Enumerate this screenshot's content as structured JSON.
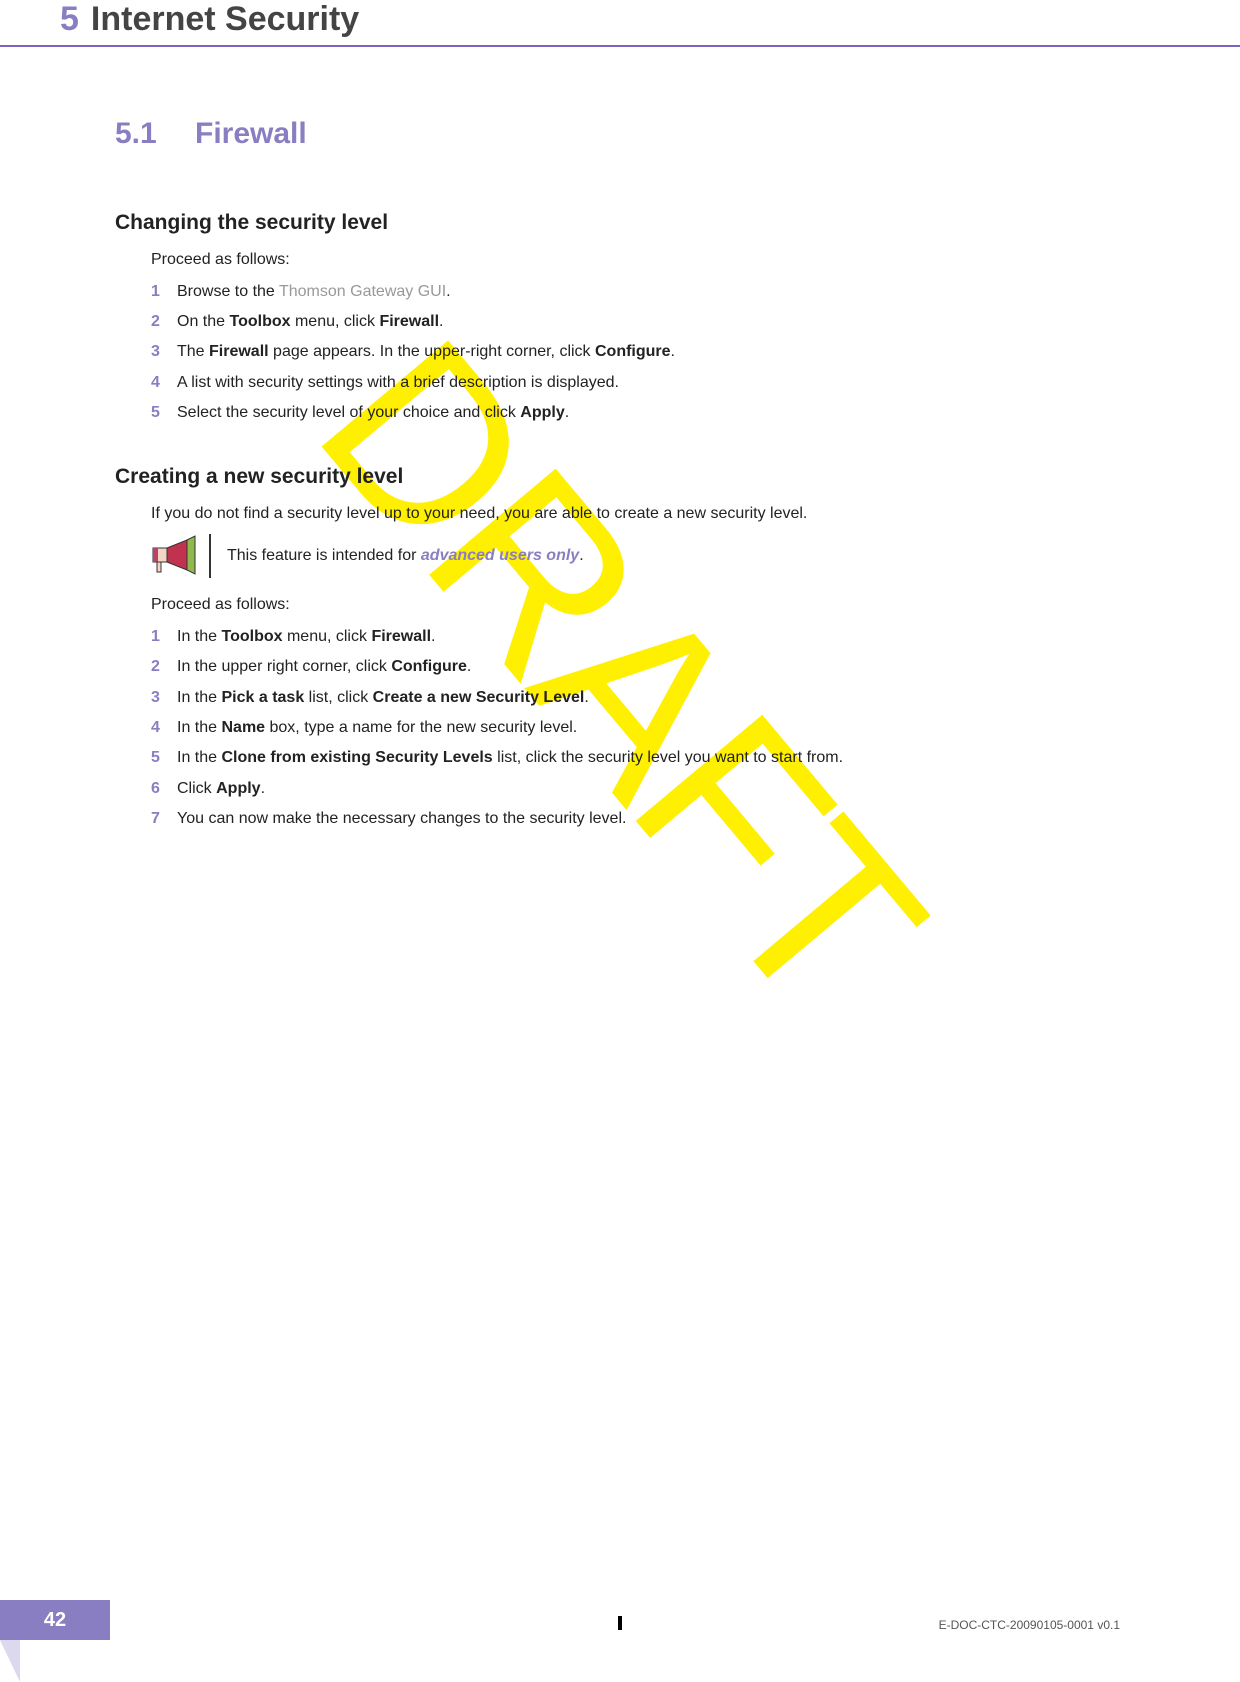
{
  "header": {
    "chapter_num": "5",
    "chapter_title": "Internet Security"
  },
  "section": {
    "num": "5.1",
    "title": "Firewall"
  },
  "block1": {
    "heading": "Changing the security level",
    "intro": "Proceed as follows:",
    "steps": [
      {
        "n": "1",
        "pre": "Browse to the ",
        "link": "Thomson Gateway GUI",
        "post": "."
      },
      {
        "n": "2",
        "pre": "On the ",
        "b1": "Toolbox",
        "mid": " menu, click ",
        "b2": "Firewall",
        "post": "."
      },
      {
        "n": "3",
        "pre": "The ",
        "b1": "Firewall",
        "mid": " page appears. In the upper-right corner, click ",
        "b2": "Configure",
        "post": "."
      },
      {
        "n": "4",
        "plain": "A list with security settings with a brief description is displayed."
      },
      {
        "n": "5",
        "pre": "Select the security level of your choice and click ",
        "b1": "Apply",
        "post": "."
      }
    ]
  },
  "block2": {
    "heading": "Creating a new security level",
    "intro1": "If you do not find a security level up to your need, you are able to create a new security level.",
    "note_pre": "This feature is intended for ",
    "note_em": "advanced users only",
    "note_post": ".",
    "intro2": "Proceed as follows:",
    "steps": [
      {
        "n": "1",
        "pre": "In the ",
        "b1": "Toolbox",
        "mid": " menu, click ",
        "b2": "Firewall",
        "post": "."
      },
      {
        "n": "2",
        "pre": "In the upper right corner, click ",
        "b1": "Configure",
        "post": "."
      },
      {
        "n": "3",
        "pre": "In the ",
        "b1": "Pick a task",
        "mid": " list, click ",
        "b2": "Create a new Security Level",
        "post": "."
      },
      {
        "n": "4",
        "pre": "In the ",
        "b1": "Name",
        "mid": " box, type a name for the new security level.",
        "post": ""
      },
      {
        "n": "5",
        "pre": "In the ",
        "b1": "Clone from existing Security Levels",
        "mid": " list, click the security level you want to start from.",
        "post": ""
      },
      {
        "n": "6",
        "pre": "Click ",
        "b1": "Apply",
        "post": "."
      },
      {
        "n": "7",
        "plain": "You can now make the necessary changes to the security level."
      }
    ]
  },
  "watermark": "DRAFT",
  "footer": {
    "page": "42",
    "doc_id": "E-DOC-CTC-20090105-0001 v0.1"
  }
}
